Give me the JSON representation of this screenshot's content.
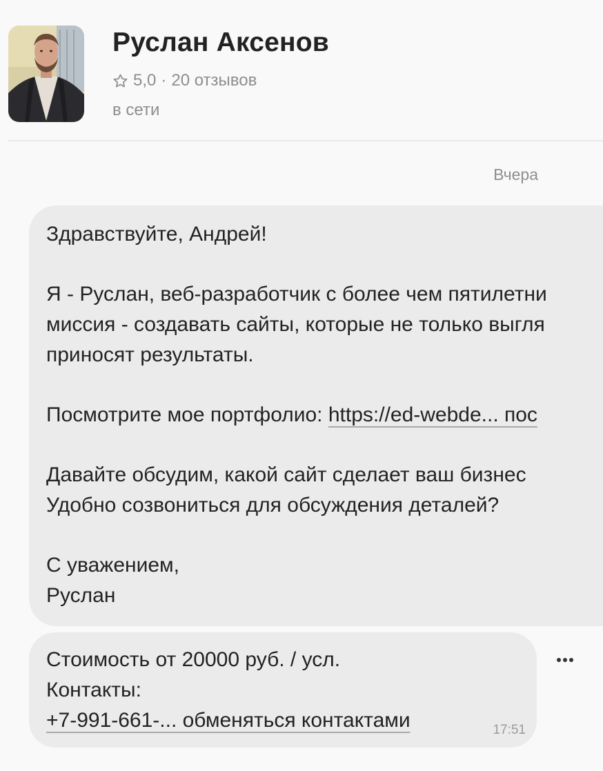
{
  "profile": {
    "name": "Руслан Аксенов",
    "rating": "5,0",
    "separator": "·",
    "reviews": "20 отзывов",
    "status": "в сети",
    "star_icon": "star-outline-icon"
  },
  "chat": {
    "date_label": "Вчера",
    "message": {
      "greeting": "Здравствуйте, Андрей!",
      "intro_line1": "Я - Руслан, веб-разработчик с более чем пятилетни",
      "intro_line2": "миссия - создавать сайты, которые не только выгля",
      "intro_line3": "приносят результаты.",
      "portfolio_prefix": "Посмотрите мое портфолио: ",
      "portfolio_link": "https://ed-webde... пос",
      "discuss_line1": "Давайте обсудим, какой сайт сделает ваш бизнес",
      "discuss_line2": "Удобно созвониться для обсуждения деталей?",
      "closing_line1": "С уважением,",
      "closing_line2": "Руслан"
    },
    "price_message": {
      "price": "Стоимость от 20000 руб. / усл.",
      "contacts_label": "Контакты:",
      "contacts_link": "+7-991-661-... обменяться контактами",
      "time": "17:51"
    },
    "more_icon": "more-horizontal-icon"
  },
  "colors": {
    "background": "#f9f9f9",
    "bubble": "#ebebeb",
    "text": "#222222",
    "muted": "#8e8e8e"
  }
}
